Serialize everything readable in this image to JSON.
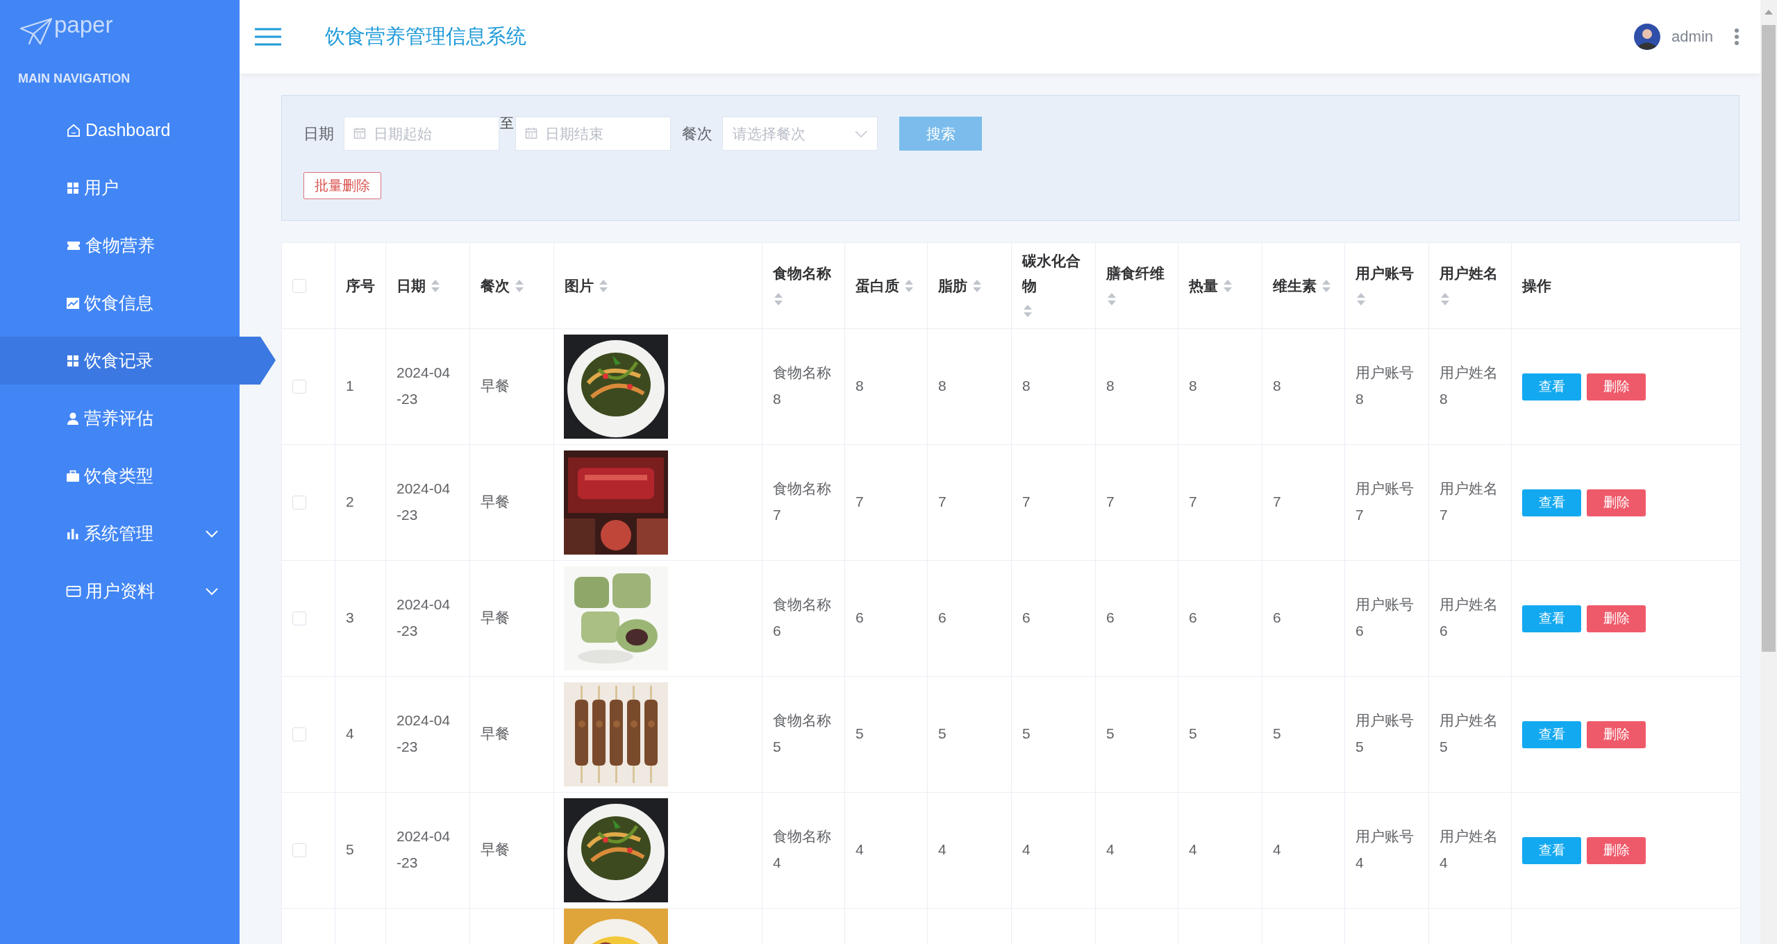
{
  "sidebar": {
    "logo": "paper",
    "section_title": "MAIN NAVIGATION",
    "items": [
      {
        "label": "Dashboard",
        "kind": "link",
        "selected": false
      },
      {
        "label": "用户",
        "kind": "link",
        "selected": false
      },
      {
        "label": "食物营养",
        "kind": "link",
        "selected": false
      },
      {
        "label": "饮食信息",
        "kind": "link",
        "selected": false
      },
      {
        "label": "饮食记录",
        "kind": "link",
        "selected": true
      },
      {
        "label": "营养评估",
        "kind": "link",
        "selected": false
      },
      {
        "label": "饮食类型",
        "kind": "link",
        "selected": false
      },
      {
        "label": "系统管理",
        "kind": "group",
        "selected": false,
        "expanded": false
      },
      {
        "label": "用户资料",
        "kind": "group",
        "selected": false,
        "expanded": false
      }
    ]
  },
  "header": {
    "title": "饮食营养管理信息系统",
    "user": "admin"
  },
  "filter": {
    "date_label": "日期",
    "date_start_placeholder": "日期起始",
    "range_separator": "至",
    "date_end_placeholder": "日期结束",
    "meal_label": "餐次",
    "meal_placeholder": "请选择餐次",
    "search_button": "搜索",
    "batch_delete_button": "批量删除"
  },
  "table": {
    "select_all_checked": false,
    "columns": [
      {
        "label": "序号",
        "kind": "text",
        "sortable": false
      },
      {
        "label": "日期",
        "kind": "text",
        "sortable": true
      },
      {
        "label": "餐次",
        "kind": "text",
        "sortable": true
      },
      {
        "label": "图片",
        "kind": "picture",
        "sortable": true
      },
      {
        "label": "食物名称",
        "kind": "text",
        "sortable": true
      },
      {
        "label": "蛋白质",
        "kind": "text",
        "sortable": true
      },
      {
        "label": "脂肪",
        "kind": "text",
        "sortable": true
      },
      {
        "label": "碳水化合物",
        "kind": "text",
        "sortable": true
      },
      {
        "label": "膳食纤维",
        "kind": "text",
        "sortable": true
      },
      {
        "label": "热量",
        "kind": "text",
        "sortable": true
      },
      {
        "label": "维生素",
        "kind": "text",
        "sortable": true
      },
      {
        "label": "用户账号",
        "kind": "text",
        "sortable": true
      },
      {
        "label": "用户姓名",
        "kind": "text",
        "sortable": true
      },
      {
        "label": "操作",
        "kind": "actions",
        "sortable": false
      }
    ],
    "rows": [
      {
        "checked": false,
        "picture": {
          "kind": "picture"
        },
        "values": [
          "1",
          "2024-04-23",
          "早餐",
          "食物名称8",
          "8",
          "8",
          "8",
          "8",
          "8",
          "8",
          "用户账号8",
          "用户姓名8"
        ],
        "actions": [
          "查看",
          "删除"
        ]
      },
      {
        "checked": false,
        "picture": {
          "kind": "picture"
        },
        "values": [
          "2",
          "2024-04-23",
          "早餐",
          "食物名称7",
          "7",
          "7",
          "7",
          "7",
          "7",
          "7",
          "用户账号7",
          "用户姓名7"
        ],
        "actions": [
          "查看",
          "删除"
        ]
      },
      {
        "checked": false,
        "picture": {
          "kind": "picture"
        },
        "values": [
          "3",
          "2024-04-23",
          "早餐",
          "食物名称6",
          "6",
          "6",
          "6",
          "6",
          "6",
          "6",
          "用户账号6",
          "用户姓名6"
        ],
        "actions": [
          "查看",
          "删除"
        ]
      },
      {
        "checked": false,
        "picture": {
          "kind": "picture"
        },
        "values": [
          "4",
          "2024-04-23",
          "早餐",
          "食物名称5",
          "5",
          "5",
          "5",
          "5",
          "5",
          "5",
          "用户账号5",
          "用户姓名5"
        ],
        "actions": [
          "查看",
          "删除"
        ]
      },
      {
        "checked": false,
        "picture": {
          "kind": "picture"
        },
        "values": [
          "5",
          "2024-04-23",
          "早餐",
          "食物名称4",
          "4",
          "4",
          "4",
          "4",
          "4",
          "4",
          "用户账号4",
          "用户姓名4"
        ],
        "actions": [
          "查看",
          "删除"
        ]
      },
      {
        "picture": {
          "kind": "picture"
        }
      }
    ]
  }
}
